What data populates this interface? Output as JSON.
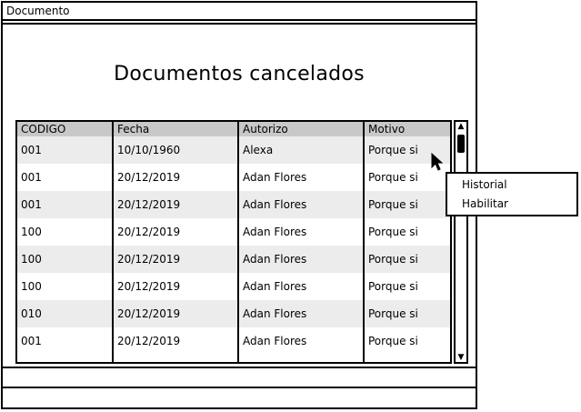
{
  "window": {
    "title": "Documento"
  },
  "page": {
    "title": "Documentos cancelados"
  },
  "table": {
    "columns": [
      "CODIGO",
      "Fecha",
      "Autorizo",
      "Motivo"
    ],
    "rows": [
      [
        "001",
        "10/10/1960",
        "Alexa",
        "Porque si"
      ],
      [
        "001",
        "20/12/2019",
        "Adan Flores",
        "Porque si"
      ],
      [
        "001",
        "20/12/2019",
        "Adan Flores",
        "Porque si"
      ],
      [
        "100",
        "20/12/2019",
        "Adan Flores",
        "Porque si"
      ],
      [
        "100",
        "20/12/2019",
        "Adan Flores",
        "Porque si"
      ],
      [
        "100",
        "20/12/2019",
        "Adan Flores",
        "Porque si"
      ],
      [
        "010",
        "20/12/2019",
        "Adan Flores",
        "Porque si"
      ],
      [
        "001",
        "20/12/2019",
        "Adan Flores",
        "Porque si"
      ]
    ]
  },
  "context_menu": {
    "items": [
      "Historial",
      "Habilitar"
    ]
  },
  "icons": {
    "cursor": "mouse-pointer-icon",
    "scroll_up": "triangle-up-icon",
    "scroll_down": "triangle-down-icon"
  },
  "colors": {
    "header_bg": "#c8c8c8",
    "alt_row_bg": "#ececec",
    "border": "#000000"
  }
}
